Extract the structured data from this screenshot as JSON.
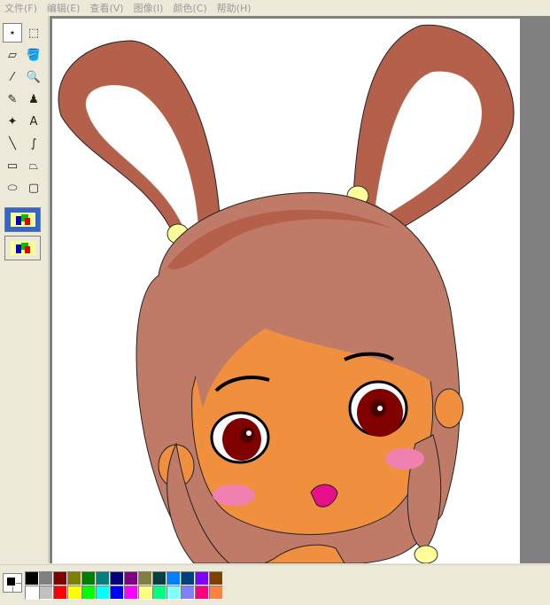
{
  "menu": [
    "文件(F)",
    "编辑(E)",
    "查看(V)",
    "图像(I)",
    "颜色(C)",
    "帮助(H)"
  ],
  "tools": [
    {
      "name": "free-form-select-icon",
      "glyph": "⋆",
      "sel": true
    },
    {
      "name": "select-rect-icon",
      "glyph": "⬚"
    },
    {
      "name": "eraser-icon",
      "glyph": "▱"
    },
    {
      "name": "fill-bucket-icon",
      "glyph": "🪣"
    },
    {
      "name": "pick-color-icon",
      "glyph": "⁄"
    },
    {
      "name": "magnifier-icon",
      "glyph": "🔍"
    },
    {
      "name": "pencil-icon",
      "glyph": "✎"
    },
    {
      "name": "brush-icon",
      "glyph": "♟"
    },
    {
      "name": "airbrush-icon",
      "glyph": "✦"
    },
    {
      "name": "text-tool-icon",
      "glyph": "A"
    },
    {
      "name": "line-tool-icon",
      "glyph": "╲"
    },
    {
      "name": "curve-tool-icon",
      "glyph": "∫"
    },
    {
      "name": "rectangle-tool-icon",
      "glyph": "▭"
    },
    {
      "name": "polygon-tool-icon",
      "glyph": "⏢"
    },
    {
      "name": "ellipse-tool-icon",
      "glyph": "⬭"
    },
    {
      "name": "rounded-rect-tool-icon",
      "glyph": "▢"
    }
  ],
  "palette": {
    "top": [
      "#000000",
      "#808080",
      "#800000",
      "#808000",
      "#008000",
      "#008080",
      "#000080",
      "#800080",
      "#808040",
      "#004040",
      "#0080ff",
      "#004080",
      "#8000ff",
      "#804000"
    ],
    "bottom": [
      "#ffffff",
      "#c0c0c0",
      "#ff0000",
      "#ffff00",
      "#00ff00",
      "#00ffff",
      "#0000ff",
      "#ff00ff",
      "#ffff80",
      "#00ff80",
      "#80ffff",
      "#8080ff",
      "#ff0080",
      "#ff8040"
    ]
  },
  "colors": {
    "hair": "#c07a68",
    "hair_dark": "#b5604a",
    "skin": "#f0903e",
    "eye": "#800000",
    "blush": "#f080b0",
    "mouth": "#e8108a",
    "tie": "#ffff99"
  }
}
